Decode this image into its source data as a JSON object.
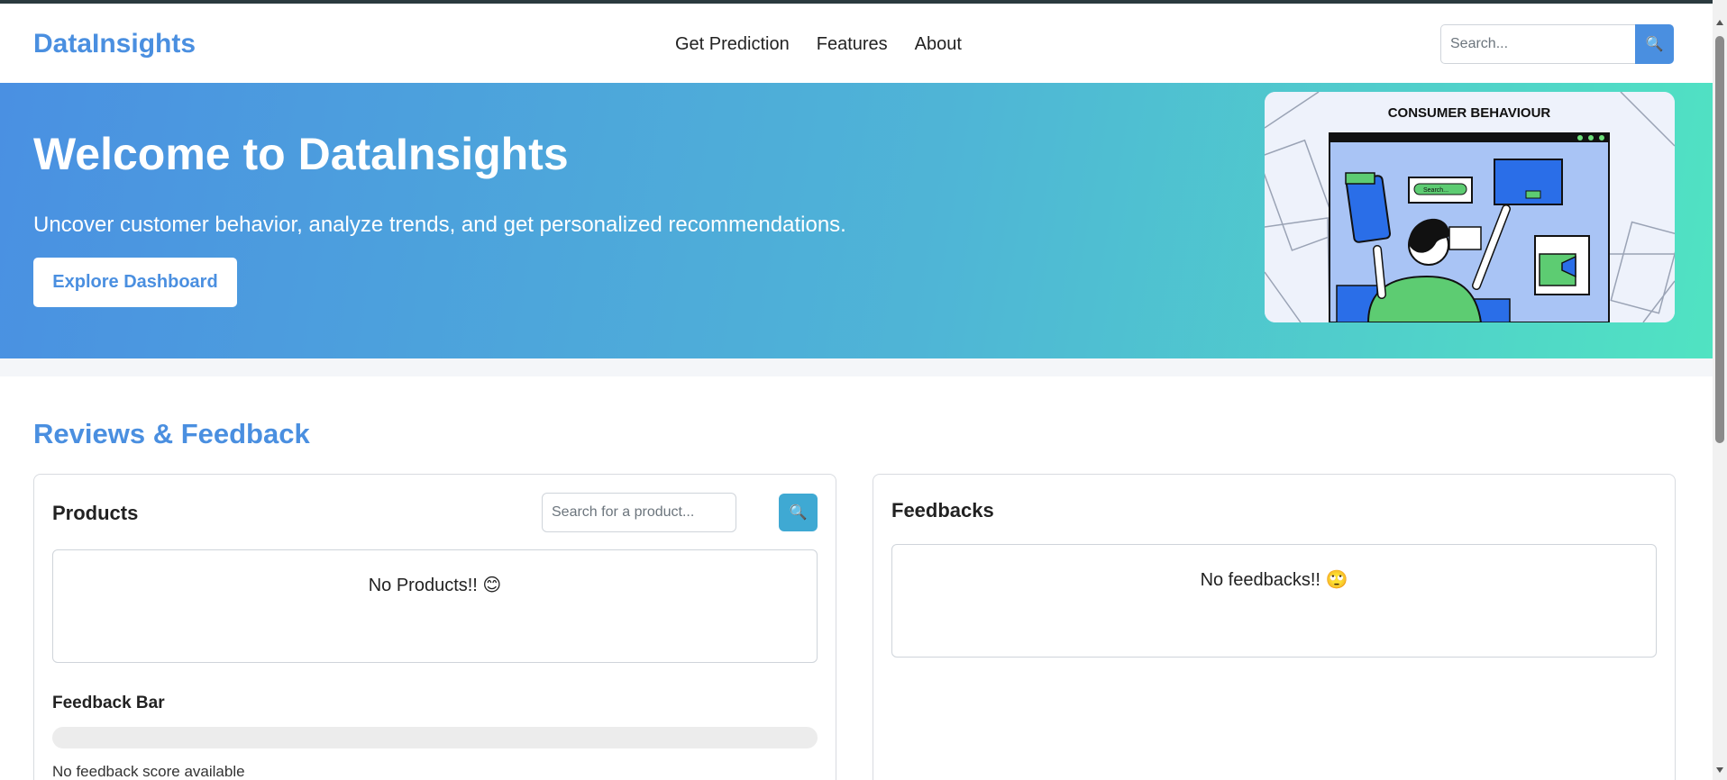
{
  "navbar": {
    "brand": "DataInsights",
    "links": [
      "Get Prediction",
      "Features",
      "About"
    ],
    "search_placeholder": "Search...",
    "search_icon": "magnifier-icon"
  },
  "hero": {
    "title": "Welcome to DataInsights",
    "subtitle": "Uncover customer behavior, analyze trends, and get personalized recommendations.",
    "button_label": "Explore Dashboard",
    "image_caption": "CONSUMER BEHAVIOUR",
    "image_search_text": "Search..."
  },
  "reviews": {
    "title": "Reviews & Feedback",
    "products": {
      "title": "Products",
      "search_placeholder": "Search for a product...",
      "search_icon": "magnifier-icon",
      "empty_text": "No Products!! 😊",
      "feedback_bar_label": "Feedback Bar",
      "feedback_score_fraction": 0,
      "feedback_note": "No feedback score available"
    },
    "feedbacks": {
      "title": "Feedbacks",
      "empty_text": "No feedbacks!! 🙄"
    }
  },
  "colors": {
    "brand": "#4a8fe0",
    "hero_gradient_start": "#4a90e2",
    "hero_gradient_end": "#50e3c2",
    "search_button": "#4a8fe0",
    "product_search_button": "#3fa9d3"
  }
}
